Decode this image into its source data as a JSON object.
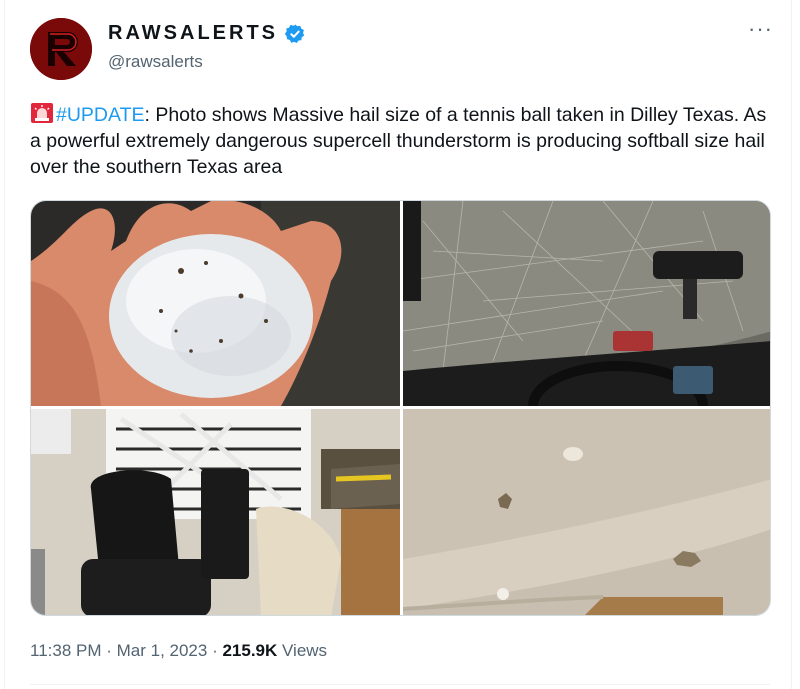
{
  "tweet": {
    "display_name": "RAWSALERTS",
    "handle": "@rawsalerts",
    "more_label": "···",
    "text": {
      "hashtag": "#UPDATE",
      "body": ": Photo shows Massive hail size of a tennis ball taken in Dilley Texas. As a powerful extremely dangerous supercell thunderstorm is producing softball size hail over the southern Texas area"
    },
    "time": "11:38 PM",
    "separator": " · ",
    "date": "Mar 1, 2023",
    "views_count": "215.9K",
    "views_label": " Views"
  },
  "icons": {
    "avatar": "rawsalerts-logo",
    "verified": "verified-badge-icon",
    "siren": "rotating-light-emoji",
    "more": "more-options-icon"
  },
  "colors": {
    "accent": "#1d9bf0",
    "text": "#0f1419",
    "secondary": "#536471",
    "avatar": "#7a0a0a"
  }
}
